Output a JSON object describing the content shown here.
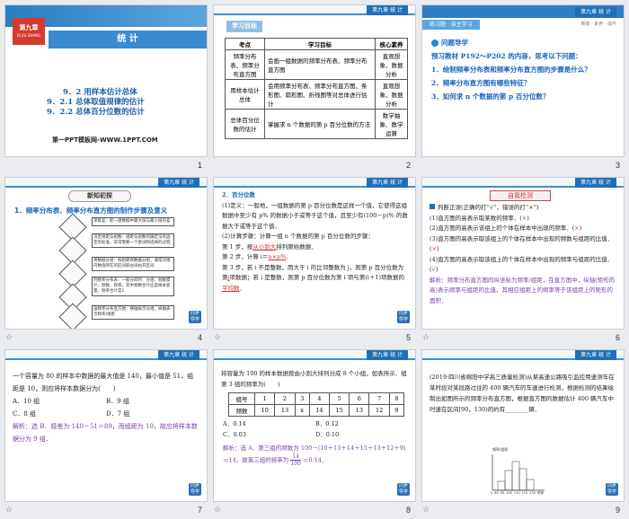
{
  "slides": [
    {
      "number": "1",
      "chapter_label": "第九章",
      "chapter_sub": "DI JIU ZHANG",
      "title": "统 计",
      "lines": [
        "9．2  用样本估计总体",
        "9．2.1  总体取值规律的估计",
        "9．2.2  总体百分位数的估计"
      ],
      "footer": "第一PPT模板网-WWW.1PPT.COM"
    },
    {
      "number": "2",
      "banner": "学习目标",
      "tag": "第九章  统  计",
      "table_headers": [
        "考点",
        "学习目标",
        "核心素养"
      ],
      "table_rows": [
        [
          "频率分布表、频率分布直方图",
          "会画一组数据的频率分布表、频率分布直方图",
          "直观想象、数据分析"
        ],
        [
          "用样本估计总体",
          "会用频率分布表、频率分布直方图、条形图、扇形图、折线图等对总体进行估计",
          "直观想象、数据分析"
        ],
        [
          "总体百分位数的估计",
          "掌握求 n 个数据的第 p 百分位数的方法",
          "数学抽象、数学运算"
        ]
      ]
    },
    {
      "number": "3",
      "banner": "练习题 · 自主学习",
      "banner_right": "新知 · 素养 · 提升",
      "tag": "第九章  统  计",
      "heading": "问题导学",
      "intro": "预习教材 P192～P202 的内容，思考以下问题：",
      "questions": [
        "1．绘制频率分布表和频率分布直方图的步骤是什么？",
        "2．频率分布直方图有哪些特征？",
        "3．如何求 n 个数据的第 p 百分位数？"
      ]
    },
    {
      "number": "4",
      "banner": "新知初探",
      "tag": "第九章  统  计",
      "heading": "1．频率分布表、频率分布直方图的制作步骤及意义",
      "flow": [
        "求极差：即一组数据中最大值与最小值的差",
        "决定组距与组数：组距与组数的确定没有固定的标准，常常需要一个尝试和选择的过程",
        "将数据分组：按组距将数据分组，通常对组内数值所在的区间取左闭右开区间",
        "列频率分布表：一般分四列：分组、频数累计、频数、频率。其中频数合计应是样本容量，频率合计是1",
        "画频率分布直方图：横轴表示分组，纵轴表示频率/组距"
      ],
      "side_labels": [
        "求极差",
        "决定组距与组数",
        "分组",
        "列表",
        "画图"
      ]
    },
    {
      "number": "5",
      "tag": "第九章  统  计",
      "heading": "2．百分位数",
      "p1": "(1)定义：一般地，一组数据的第 p 百分位数是这样一个值，它使得这组数据中至少有 p% 的数据小于或等于这个值，且至少有(100－p)% 的数据大于或等于这个值．",
      "p2": "(2)计算步骤：计算一组 n 个数据的第 p 百分位数的步骤：",
      "step1_pre": "第 1 步，按",
      "step1_fill": "从小到大",
      "step1_post": "排列原始数据．",
      "step2_pre": "第 2 步，计算 i＝",
      "step2_fill": "n×p%",
      "step2_post": "．",
      "step3_pre": "第 3 步，若 i 不是整数，而大于 i 的比邻整数为 j，则第 p 百分位数为第",
      "step3_fill": "j",
      "step3_mid": "项数据；若 i 是整数，则第 p 百分位数为第 i 项与第(i＋1)项数据的",
      "step3_fill2": "平均数",
      "step3_post": "．"
    },
    {
      "number": "6",
      "banner": "自我检测",
      "tag": "第九章  统  计",
      "heading": "判断正误(正确的打“√”，错误的打“×”)",
      "items": [
        {
          "text": "(1)直方图的高表示取某数的频率．",
          "mark": "×"
        },
        {
          "text": "(2)直方图的高表示该组上的个体在样本中出现的频率．",
          "mark": "×"
        },
        {
          "text": "(3)直方图的高表示取该组上的个体在样本中出现的频数与组距的比值．",
          "mark": "×"
        },
        {
          "text": "(4)直方图的高表示取该组上的个体在样本中出现的频率与组距的比值．",
          "mark": "√"
        }
      ],
      "analysis": "解析：频率分布直方图的纵坐标为频率/组距，在直方图中，纵轴(矩形的高)表示频率与组距的比值，其相应组距上的频率等于该组距上的矩形的面积．"
    },
    {
      "number": "7",
      "question": "一个容量为 80 的样本中数据的最大值是 140，最小值是 51，组距是 10，则应将样本数据分为(　　)",
      "answer_mark": "B",
      "options": [
        "A．10 组",
        "B．9 组",
        "C．8 组",
        "D．7 组"
      ],
      "solution": "解析：选 B．极差为 140－51＝89，而组距为 10，故应将样本数据分为 9 组．"
    },
    {
      "number": "8",
      "question": "将容量为 100 的样本数据按由小到大排列分成 8 个小组，如表所示．组第 3 组的频率为(　　)",
      "table_headers": [
        "组号",
        "1",
        "2",
        "3",
        "4",
        "5",
        "6",
        "7",
        "8"
      ],
      "table_rows": [
        [
          "频数",
          "10",
          "13",
          "x",
          "14",
          "15",
          "13",
          "12",
          "9"
        ]
      ],
      "options": [
        "A．0.14",
        "B．0.12",
        "C．0.03",
        "D．0.10"
      ],
      "solution1": "解析：选 A．第三组的频数为 100－(10＋13＋14＋15＋13＋12＋9)＝14，故第三组的频率为",
      "solution2": "＝0.14．",
      "frac_num": "14",
      "frac_den": "100"
    },
    {
      "number": "9",
      "question": "(2019·四川省绵阳中学高三质量检测)从某高速公路吸引监控用速测车在某时段对某段路过往的 400 辆汽车的车速进行检测，根据检测的结果绘制出如图所示的频率分布直方图，根据直方图的数据估计 400 辆汽车中时速在区间[90，130)的约有________辆．",
      "chart_ylabel": "频率/组距",
      "chart_xlabel": "时速",
      "chart_ticks": [
        "0",
        "80",
        "90",
        "100",
        "110",
        "120",
        "130"
      ]
    }
  ],
  "stars": [
    "☆",
    "☆",
    "☆",
    "☆",
    "☆",
    "☆"
  ],
  "logo_text": "同步导学"
}
